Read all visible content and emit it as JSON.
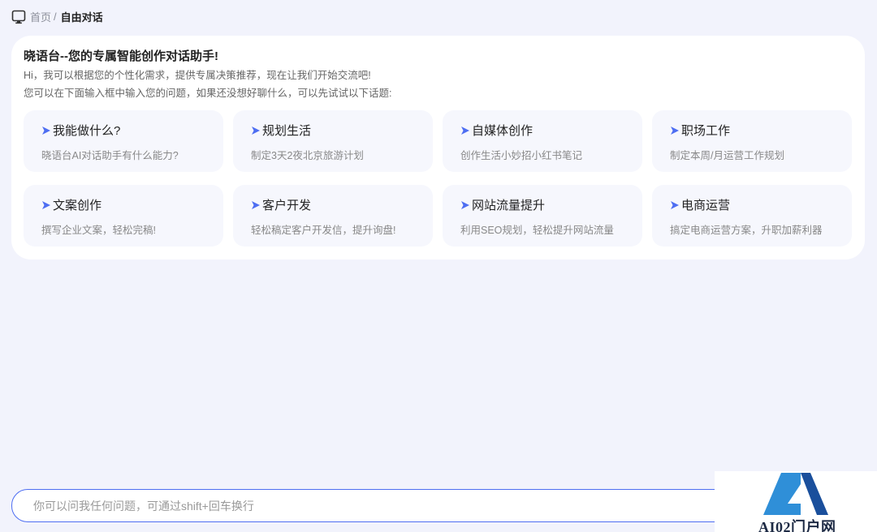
{
  "breadcrumb": {
    "home": "首页",
    "separator": "/",
    "current": "自由对话"
  },
  "welcome": {
    "title": "晓语台--您的专属智能创作对话助手!",
    "line1": "Hi，我可以根据您的个性化需求，提供专属决策推荐，现在让我们开始交流吧!",
    "line2": "您可以在下面输入框中输入您的问题，如果还没想好聊什么，可以先试试以下话题:"
  },
  "topics": [
    {
      "title": "我能做什么?",
      "desc": "晓语台AI对话助手有什么能力?"
    },
    {
      "title": "规划生活",
      "desc": "制定3天2夜北京旅游计划"
    },
    {
      "title": "自媒体创作",
      "desc": "创作生活小妙招小红书笔记"
    },
    {
      "title": "职场工作",
      "desc": "制定本周/月运营工作规划"
    },
    {
      "title": "文案创作",
      "desc": "撰写企业文案，轻松完稿!"
    },
    {
      "title": "客户开发",
      "desc": "轻松稿定客户开发信，提升询盘!"
    },
    {
      "title": "网站流量提升",
      "desc": "利用SEO规划，轻松提升网站流量"
    },
    {
      "title": "电商运营",
      "desc": "搞定电商运营方案，升职加薪利器"
    }
  ],
  "input": {
    "placeholder": "你可以问我任何问题，可通过shift+回车换行",
    "value": ""
  },
  "watermark": {
    "text": "AI02门户网"
  },
  "colors": {
    "accent": "#4e6ef2",
    "background": "#f2f3fc",
    "card": "#ffffff",
    "topic_bg": "#f6f7fd"
  },
  "icons": {
    "breadcrumb": "monitor-icon",
    "topic": "send-arrow-icon"
  }
}
